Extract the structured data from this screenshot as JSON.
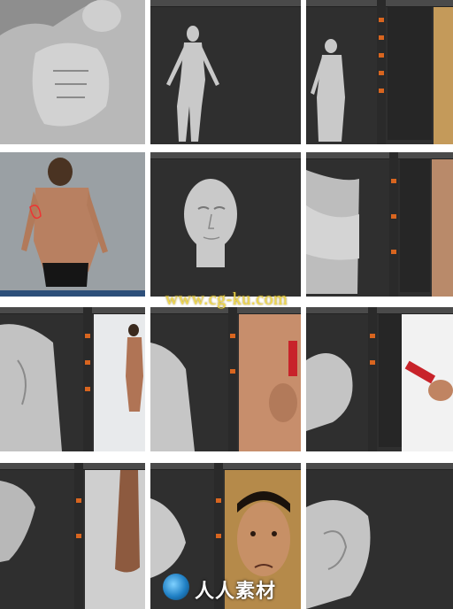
{
  "watermark": {
    "text": "www.cg-ku.com"
  },
  "logo": {
    "text": "人人素材"
  },
  "thumbnails": [
    {
      "name": "muscular-torso-sculpt"
    },
    {
      "name": "full-body-sculpt-front"
    },
    {
      "name": "back-view-sculpt-ui"
    },
    {
      "name": "reference-photo-back"
    },
    {
      "name": "head-sculpt"
    },
    {
      "name": "hip-cloth-sculpt"
    },
    {
      "name": "back-detail-with-reference"
    },
    {
      "name": "chest-with-reference"
    },
    {
      "name": "arm-with-reference"
    },
    {
      "name": "foot-with-reference"
    },
    {
      "name": "nose-with-face-reference"
    },
    {
      "name": "ear-sculpt"
    }
  ],
  "colors": {
    "accent": "#d8651f",
    "ui_bg": "#2f2f2f",
    "clay": "#c9c9c9",
    "watermark": "#f0d84a"
  }
}
